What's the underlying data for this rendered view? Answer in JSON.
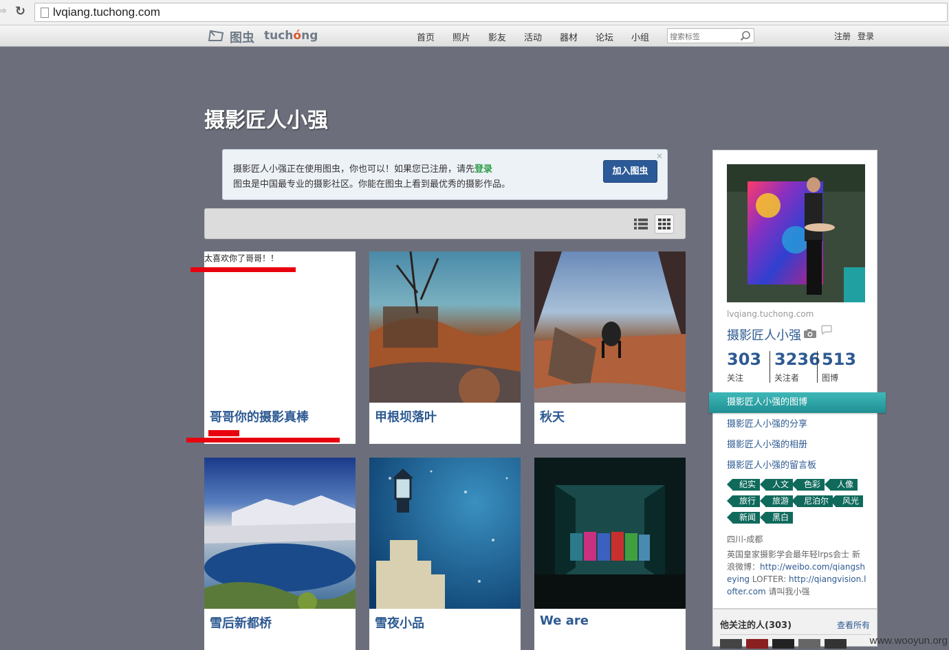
{
  "browser": {
    "url": "lvqiang.tuchong.com"
  },
  "header": {
    "logo_cn": "图虫",
    "logo_en_pre": "tuch",
    "logo_en_o": "ó",
    "logo_en_post": "ng",
    "nav": [
      "首页",
      "照片",
      "影友",
      "活动",
      "器材",
      "论坛",
      "小组"
    ],
    "search_placeholder": "搜索标签",
    "register": "注册",
    "login": "登录"
  },
  "page": {
    "title": "摄影匠人小强"
  },
  "notice": {
    "line1_prefix": "摄影匠人小强正在使用图虫，你也可以！如果您已注册，请先",
    "line1_link": "登录",
    "line2": "图虫是中国最专业的摄影社区。你能在图虫上看到最优秀的摄影作品。",
    "join_button": "加入图虫",
    "close": "×"
  },
  "cards": [
    {
      "title": "哥哥你的摄影真棒",
      "note": "太喜欢你了哥哥！！"
    },
    {
      "title": "甲根坝落叶"
    },
    {
      "title": "秋天"
    },
    {
      "title": "雪后新都桥"
    },
    {
      "title": "雪夜小品"
    },
    {
      "title": "We are"
    }
  ],
  "profile": {
    "domain": "lvqiang.tuchong.com",
    "name": "摄影匠人小强",
    "stats": [
      {
        "num": "303",
        "label": "关注"
      },
      {
        "num": "3236",
        "label": "关注者"
      },
      {
        "num": "513",
        "label": "图博"
      }
    ],
    "menu": [
      "摄影匠人小强的图博",
      "摄影匠人小强的分享",
      "摄影匠人小强的相册",
      "摄影匠人小强的留言板"
    ],
    "tags": [
      "纪实",
      "人文",
      "色彩",
      "人像",
      "旅行",
      "旅游",
      "尼泊尔",
      "风光",
      "新闻",
      "黑白"
    ],
    "location": "四川-成都",
    "bio_prefix": "英国皇家摄影学会最年轻lrps会士 新浪微博：",
    "bio_link1": "http://weibo.com/qiangsheying",
    "bio_mid": " LOFTER: ",
    "bio_link2": "http://qiangvision.lofter.com",
    "bio_suffix": " 请叫我小强",
    "following_title": "他关注的人(303)",
    "following_all": "查看所有"
  },
  "watermark": "www.wooyun.org",
  "colors": {
    "background": "#6c6f7b",
    "link_blue": "#2e5a92",
    "join_button": "#2c5a98",
    "tag_green": "#0f6a5c",
    "active_menu": "#2aa3a6",
    "annotation_red": "#e8000e"
  }
}
